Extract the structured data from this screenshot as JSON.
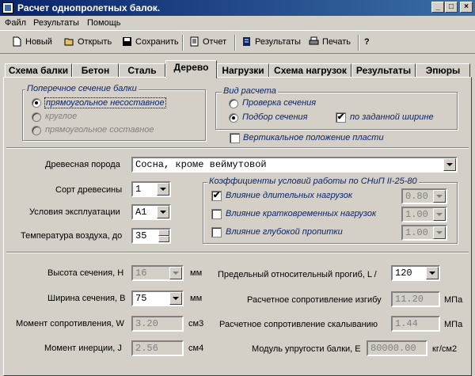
{
  "window": {
    "title": "Расчет однопролетных балок.",
    "min": "_",
    "max": "□",
    "close": "×"
  },
  "menu": [
    "Файл",
    "Результаты",
    "Помощь"
  ],
  "toolbar": {
    "new": "Новый",
    "open": "Открыть",
    "save": "Сохранить",
    "report": "Отчет",
    "results": "Результаты",
    "print": "Печать",
    "help": "?"
  },
  "tabs": [
    "Схема балки",
    "Бетон",
    "Сталь",
    "Дерево",
    "Нагрузки",
    "Схема нагрузок",
    "Результаты",
    "Эпюры"
  ],
  "active_tab": "Дерево",
  "section": {
    "title": "Поперечное сечение балки",
    "options": [
      "прямоугольное несоставное",
      "круглое",
      "прямоугольное составное"
    ],
    "selected": "прямоугольное несоставное"
  },
  "calc": {
    "title": "Вид расчета",
    "options": [
      "Проверка сечения",
      "Подбор сечения"
    ],
    "selected": "Подбор сечения",
    "by_width_label": "по заданной ширине",
    "by_width_checked": true,
    "vertical_label": "Вертикальное положение пласти",
    "vertical_checked": false
  },
  "wood": {
    "species_label": "Древесная порода",
    "species_value": "Сосна, кроме веймутовой",
    "grade_label": "Сорт древесины",
    "grade_value": "1",
    "conditions_label": "Условия эксплуатации",
    "conditions_value": "А1",
    "temp_label": "Температура воздуха, до",
    "temp_value": "35"
  },
  "coeffs": {
    "title": "Коэффициенты условий работы по СНиП II-25-80",
    "items": [
      {
        "label": "Влияние длительных нагрузок",
        "checked": true,
        "value": "0.80"
      },
      {
        "label": "Влияние кратковременных нагрузок",
        "checked": false,
        "value": "1.00"
      },
      {
        "label": "Влияние глубокой пропитки",
        "checked": false,
        "value": "1.00"
      }
    ]
  },
  "params": {
    "height_label": "Высота сечения, H",
    "height_value": "16",
    "height_unit": "мм",
    "width_label": "Ширина сечения, B",
    "width_value": "75",
    "width_unit": "мм",
    "moment_res_label": "Момент сопротивления, W",
    "moment_res_value": "3.20",
    "moment_res_unit": "см3",
    "inertia_label": "Момент инерции, J",
    "inertia_value": "2.56",
    "inertia_unit": "см4",
    "deflection_label": "Предельный относительный прогиб, L /",
    "deflection_value": "120",
    "bending_label": "Расчетное сопротивление изгибу",
    "bending_value": "11.20",
    "bending_unit": "МПа",
    "shear_label": "Расчетное сопротивление скалыванию",
    "shear_value": "1.44",
    "shear_unit": "МПа",
    "modulus_label": "Модуль упругости балки, Е",
    "modulus_value": "80000.00",
    "modulus_unit": "кг/см2"
  }
}
